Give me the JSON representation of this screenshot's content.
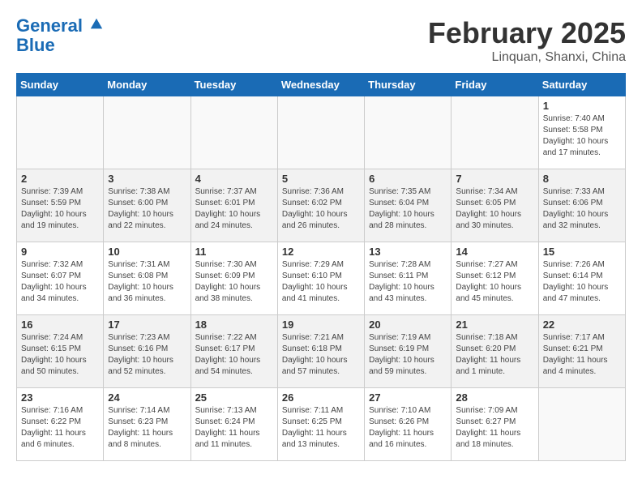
{
  "header": {
    "logo_line1": "General",
    "logo_line2": "Blue",
    "month": "February 2025",
    "location": "Linquan, Shanxi, China"
  },
  "weekdays": [
    "Sunday",
    "Monday",
    "Tuesday",
    "Wednesday",
    "Thursday",
    "Friday",
    "Saturday"
  ],
  "weeks": [
    [
      {
        "day": "",
        "info": ""
      },
      {
        "day": "",
        "info": ""
      },
      {
        "day": "",
        "info": ""
      },
      {
        "day": "",
        "info": ""
      },
      {
        "day": "",
        "info": ""
      },
      {
        "day": "",
        "info": ""
      },
      {
        "day": "1",
        "info": "Sunrise: 7:40 AM\nSunset: 5:58 PM\nDaylight: 10 hours\nand 17 minutes."
      }
    ],
    [
      {
        "day": "2",
        "info": "Sunrise: 7:39 AM\nSunset: 5:59 PM\nDaylight: 10 hours\nand 19 minutes."
      },
      {
        "day": "3",
        "info": "Sunrise: 7:38 AM\nSunset: 6:00 PM\nDaylight: 10 hours\nand 22 minutes."
      },
      {
        "day": "4",
        "info": "Sunrise: 7:37 AM\nSunset: 6:01 PM\nDaylight: 10 hours\nand 24 minutes."
      },
      {
        "day": "5",
        "info": "Sunrise: 7:36 AM\nSunset: 6:02 PM\nDaylight: 10 hours\nand 26 minutes."
      },
      {
        "day": "6",
        "info": "Sunrise: 7:35 AM\nSunset: 6:04 PM\nDaylight: 10 hours\nand 28 minutes."
      },
      {
        "day": "7",
        "info": "Sunrise: 7:34 AM\nSunset: 6:05 PM\nDaylight: 10 hours\nand 30 minutes."
      },
      {
        "day": "8",
        "info": "Sunrise: 7:33 AM\nSunset: 6:06 PM\nDaylight: 10 hours\nand 32 minutes."
      }
    ],
    [
      {
        "day": "9",
        "info": "Sunrise: 7:32 AM\nSunset: 6:07 PM\nDaylight: 10 hours\nand 34 minutes."
      },
      {
        "day": "10",
        "info": "Sunrise: 7:31 AM\nSunset: 6:08 PM\nDaylight: 10 hours\nand 36 minutes."
      },
      {
        "day": "11",
        "info": "Sunrise: 7:30 AM\nSunset: 6:09 PM\nDaylight: 10 hours\nand 38 minutes."
      },
      {
        "day": "12",
        "info": "Sunrise: 7:29 AM\nSunset: 6:10 PM\nDaylight: 10 hours\nand 41 minutes."
      },
      {
        "day": "13",
        "info": "Sunrise: 7:28 AM\nSunset: 6:11 PM\nDaylight: 10 hours\nand 43 minutes."
      },
      {
        "day": "14",
        "info": "Sunrise: 7:27 AM\nSunset: 6:12 PM\nDaylight: 10 hours\nand 45 minutes."
      },
      {
        "day": "15",
        "info": "Sunrise: 7:26 AM\nSunset: 6:14 PM\nDaylight: 10 hours\nand 47 minutes."
      }
    ],
    [
      {
        "day": "16",
        "info": "Sunrise: 7:24 AM\nSunset: 6:15 PM\nDaylight: 10 hours\nand 50 minutes."
      },
      {
        "day": "17",
        "info": "Sunrise: 7:23 AM\nSunset: 6:16 PM\nDaylight: 10 hours\nand 52 minutes."
      },
      {
        "day": "18",
        "info": "Sunrise: 7:22 AM\nSunset: 6:17 PM\nDaylight: 10 hours\nand 54 minutes."
      },
      {
        "day": "19",
        "info": "Sunrise: 7:21 AM\nSunset: 6:18 PM\nDaylight: 10 hours\nand 57 minutes."
      },
      {
        "day": "20",
        "info": "Sunrise: 7:19 AM\nSunset: 6:19 PM\nDaylight: 10 hours\nand 59 minutes."
      },
      {
        "day": "21",
        "info": "Sunrise: 7:18 AM\nSunset: 6:20 PM\nDaylight: 11 hours\nand 1 minute."
      },
      {
        "day": "22",
        "info": "Sunrise: 7:17 AM\nSunset: 6:21 PM\nDaylight: 11 hours\nand 4 minutes."
      }
    ],
    [
      {
        "day": "23",
        "info": "Sunrise: 7:16 AM\nSunset: 6:22 PM\nDaylight: 11 hours\nand 6 minutes."
      },
      {
        "day": "24",
        "info": "Sunrise: 7:14 AM\nSunset: 6:23 PM\nDaylight: 11 hours\nand 8 minutes."
      },
      {
        "day": "25",
        "info": "Sunrise: 7:13 AM\nSunset: 6:24 PM\nDaylight: 11 hours\nand 11 minutes."
      },
      {
        "day": "26",
        "info": "Sunrise: 7:11 AM\nSunset: 6:25 PM\nDaylight: 11 hours\nand 13 minutes."
      },
      {
        "day": "27",
        "info": "Sunrise: 7:10 AM\nSunset: 6:26 PM\nDaylight: 11 hours\nand 16 minutes."
      },
      {
        "day": "28",
        "info": "Sunrise: 7:09 AM\nSunset: 6:27 PM\nDaylight: 11 hours\nand 18 minutes."
      },
      {
        "day": "",
        "info": ""
      }
    ]
  ]
}
